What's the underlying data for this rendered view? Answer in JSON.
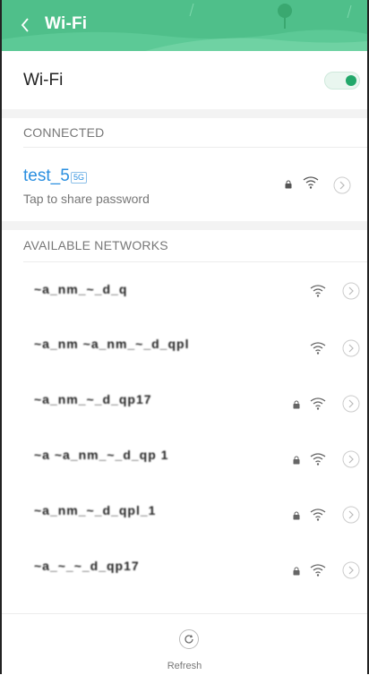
{
  "header": {
    "title": "Wi-Fi"
  },
  "wifi_row": {
    "label": "Wi-Fi",
    "enabled": true
  },
  "connected": {
    "section_title": "CONNECTED",
    "name": "test_5",
    "badge": "5G",
    "subtitle": "Tap to share password",
    "secured": true
  },
  "available": {
    "section_title": "AVAILABLE NETWORKS",
    "networks": [
      {
        "name": "~a_nm_~_d_q",
        "secured": false
      },
      {
        "name": "~a_nm ~a_nm_~_d_qpl",
        "secured": false
      },
      {
        "name": "~a_nm_~_d_qp17",
        "secured": true
      },
      {
        "name": "~a ~a_nm_~_d_qp 1",
        "secured": true
      },
      {
        "name": "~a_nm_~_d_qpl_1",
        "secured": true
      },
      {
        "name": "~a_~_~_d_qp17",
        "secured": true
      }
    ]
  },
  "refresh": {
    "label": "Refresh"
  },
  "colors": {
    "header": "#4fbf8a",
    "accent": "#2a8fe0",
    "toggle": "#22a86a"
  }
}
